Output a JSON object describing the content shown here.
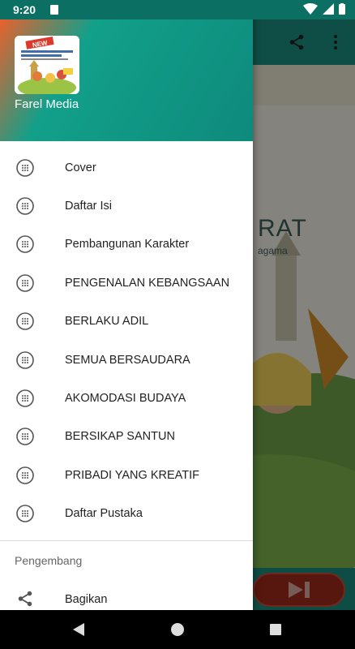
{
  "status_bar": {
    "time": "9:20"
  },
  "background_app": {
    "title_fragment": "RAT",
    "subtitle_fragment": "agama"
  },
  "drawer": {
    "header": {
      "name": "Farel Media",
      "logo_text": "NEW"
    },
    "menu_items": [
      {
        "label": "Cover"
      },
      {
        "label": "Daftar Isi"
      },
      {
        "label": "Pembangunan Karakter"
      },
      {
        "label": "PENGENALAN KEBANGSAAN"
      },
      {
        "label": "BERLAKU ADIL"
      },
      {
        "label": "SEMUA BERSAUDARA"
      },
      {
        "label": "AKOMODASI BUDAYA"
      },
      {
        "label": "BERSIKAP SANTUN"
      },
      {
        "label": "PRIBADI YANG KREATIF"
      },
      {
        "label": "Daftar Pustaka"
      }
    ],
    "section_title": "Pengembang",
    "share_label": "Bagikan"
  },
  "colors": {
    "header_teal": "#0e8a7c",
    "header_orange": "#e8612c",
    "status_bar": "#0c6f63"
  }
}
